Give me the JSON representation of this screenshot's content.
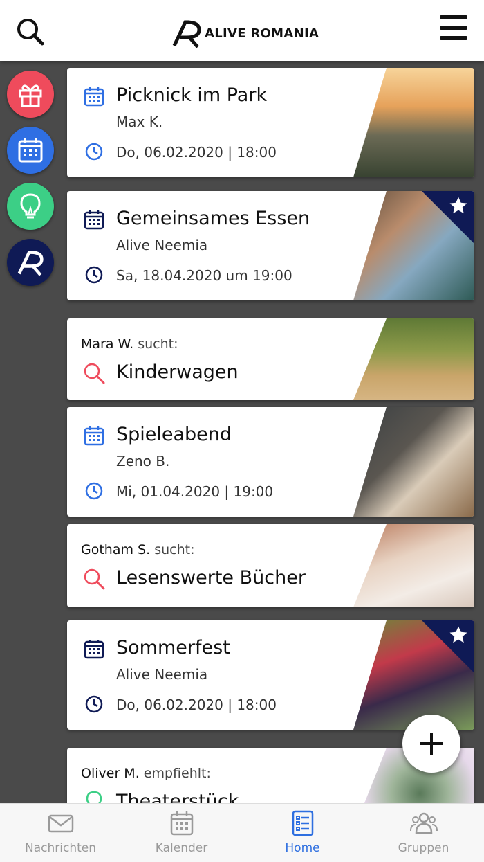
{
  "header": {
    "app_name": "ALIVE ROMANIA"
  },
  "sidebar": {
    "buttons": [
      {
        "name": "gift",
        "color": "#ef4b5c"
      },
      {
        "name": "calendar",
        "color": "#2f6fe3"
      },
      {
        "name": "lightbulb",
        "color": "#3ccf86"
      },
      {
        "name": "alive-logo",
        "color": "#0f1a55"
      }
    ]
  },
  "cards": [
    {
      "type": "event",
      "title": "Picknick im Park",
      "subtitle": "Max K.",
      "date": "Do, 06.02.2020 | 18:00",
      "icon_color": "#2f6fe3",
      "featured": false
    },
    {
      "type": "event",
      "title": "Gemeinsames Essen",
      "subtitle": "Alive Neemia",
      "date": "Sa, 18.04.2020 um 19:00",
      "icon_color": "#0f1a55",
      "featured": true
    },
    {
      "type": "search",
      "who": "Mara W.",
      "suffix": "sucht:",
      "title": "Kinderwagen",
      "icon_color": "#ef4b5c"
    },
    {
      "type": "event",
      "title": "Spieleabend",
      "subtitle": "Zeno B.",
      "date": "Mi, 01.04.2020 | 19:00",
      "icon_color": "#2f6fe3",
      "featured": false
    },
    {
      "type": "search",
      "who": "Gotham S.",
      "suffix": "sucht:",
      "title": "Lesenswerte Bücher",
      "icon_color": "#ef4b5c"
    },
    {
      "type": "event",
      "title": "Sommerfest",
      "subtitle": "Alive Neemia",
      "date": "Do, 06.02.2020 | 18:00",
      "icon_color": "#0f1a55",
      "featured": true
    },
    {
      "type": "recommend",
      "who": "Oliver M.",
      "suffix": "empfiehlt:",
      "title": "Theaterstück",
      "icon_color": "#3ccf86"
    }
  ],
  "fab": {
    "icon": "plus-icon"
  },
  "bottom_nav": [
    {
      "label": "Nachrichten",
      "icon": "envelope-icon",
      "active": false
    },
    {
      "label": "Kalender",
      "icon": "calendar-icon",
      "active": false
    },
    {
      "label": "Home",
      "icon": "list-icon",
      "active": true
    },
    {
      "label": "Gruppen",
      "icon": "group-icon",
      "active": false
    }
  ],
  "colors": {
    "accent": "#2e6fe0",
    "navy": "#0f1a55",
    "red": "#ef4b5c",
    "green": "#3ccf86"
  }
}
